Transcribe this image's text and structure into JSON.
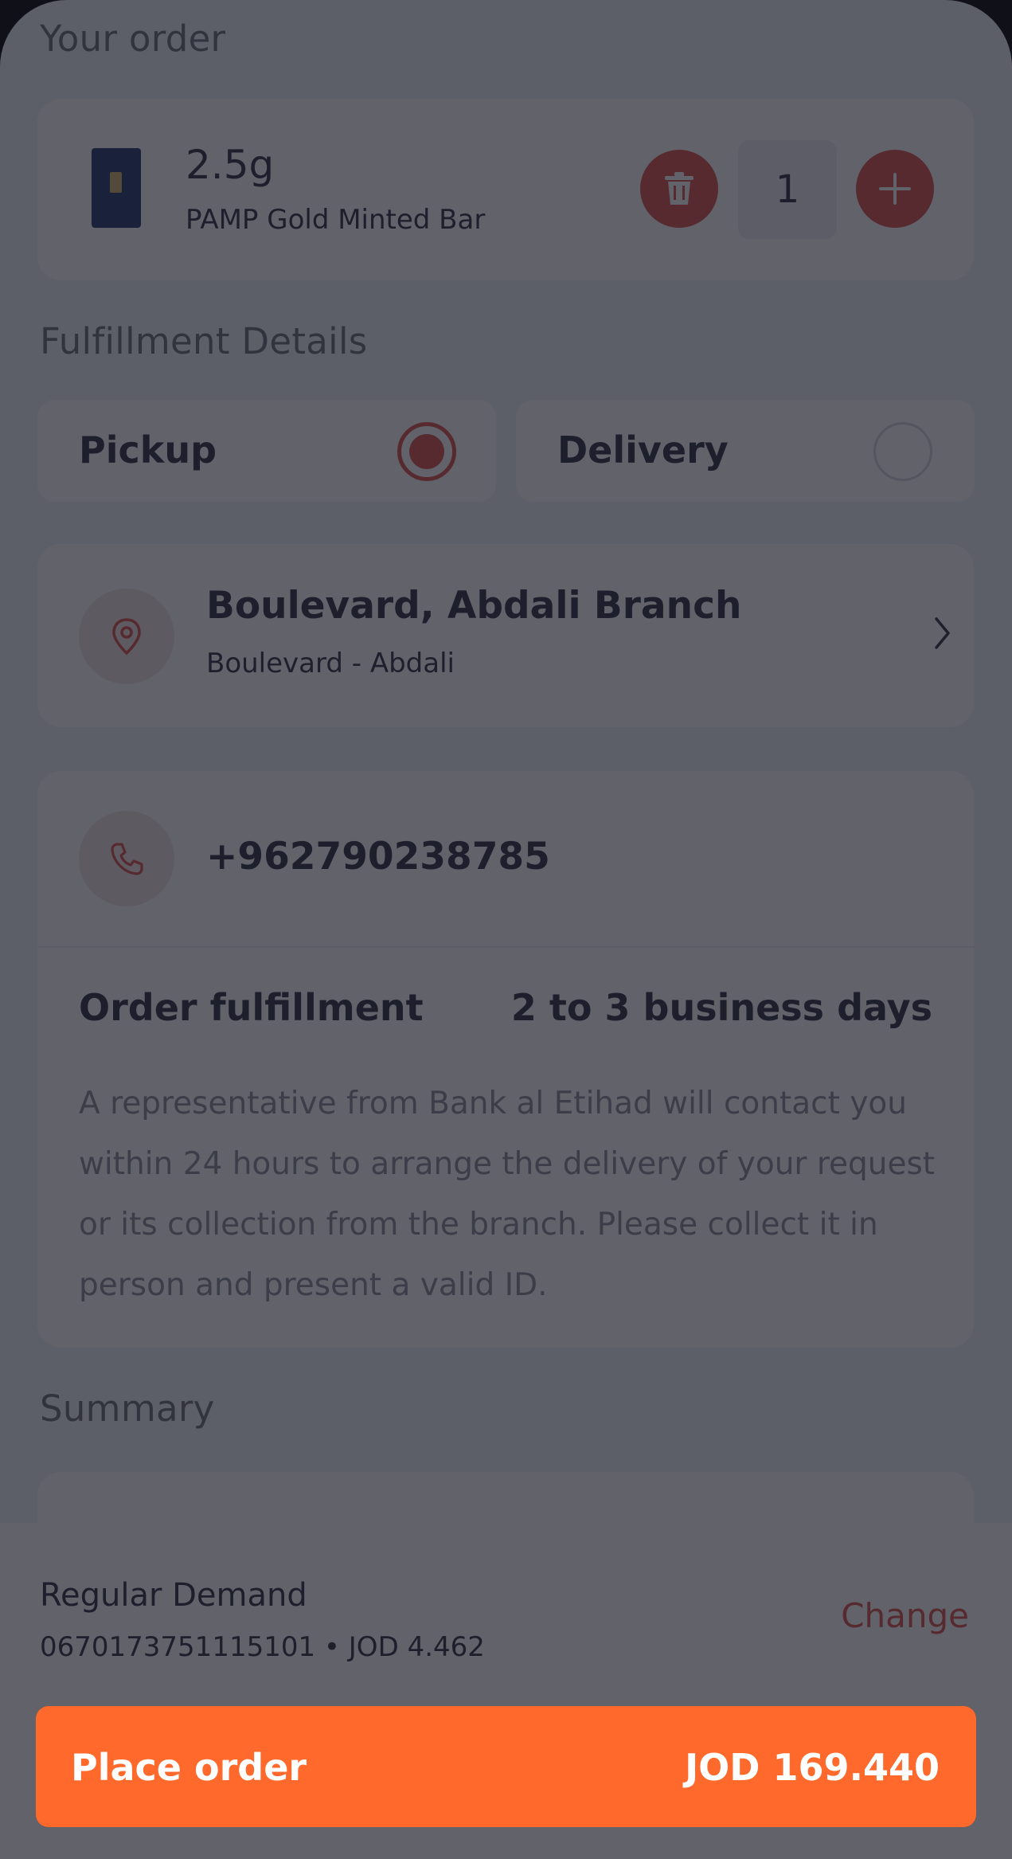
{
  "order": {
    "section_title": "Your order",
    "item": {
      "weight": "2.5g",
      "name": "PAMP Gold Minted Bar",
      "quantity": "1"
    }
  },
  "fulfillment": {
    "section_title": "Fulfillment Details",
    "options": [
      {
        "label": "Pickup",
        "selected": true
      },
      {
        "label": "Delivery",
        "selected": false
      }
    ],
    "branch": {
      "title": "Boulevard, Abdali Branch",
      "subtitle": "Boulevard - Abdali"
    },
    "phone": "+962790238785",
    "order_fulfillment_label": "Order fulfillment",
    "order_fulfillment_value": "2 to 3 business days",
    "description": "A representative from Bank al Etihad will contact you within 24 hours to arrange the delivery of your request or its collection from the branch. Please collect it in person and present a valid ID."
  },
  "summary": {
    "section_title": "Summary"
  },
  "account": {
    "name": "Regular Demand",
    "detail": "0670173751115101 • JOD 4.462",
    "change_label": "Change"
  },
  "place_order": {
    "label": "Place order",
    "amount": "JOD 169.440"
  },
  "colors": {
    "accent": "#e0534a",
    "primary_button": "#ff6a2c",
    "overlay": "rgba(22,24,36,0.68)"
  },
  "icons": [
    "trash-icon",
    "plus-icon",
    "location-pin-icon",
    "chevron-right-icon",
    "phone-icon"
  ]
}
